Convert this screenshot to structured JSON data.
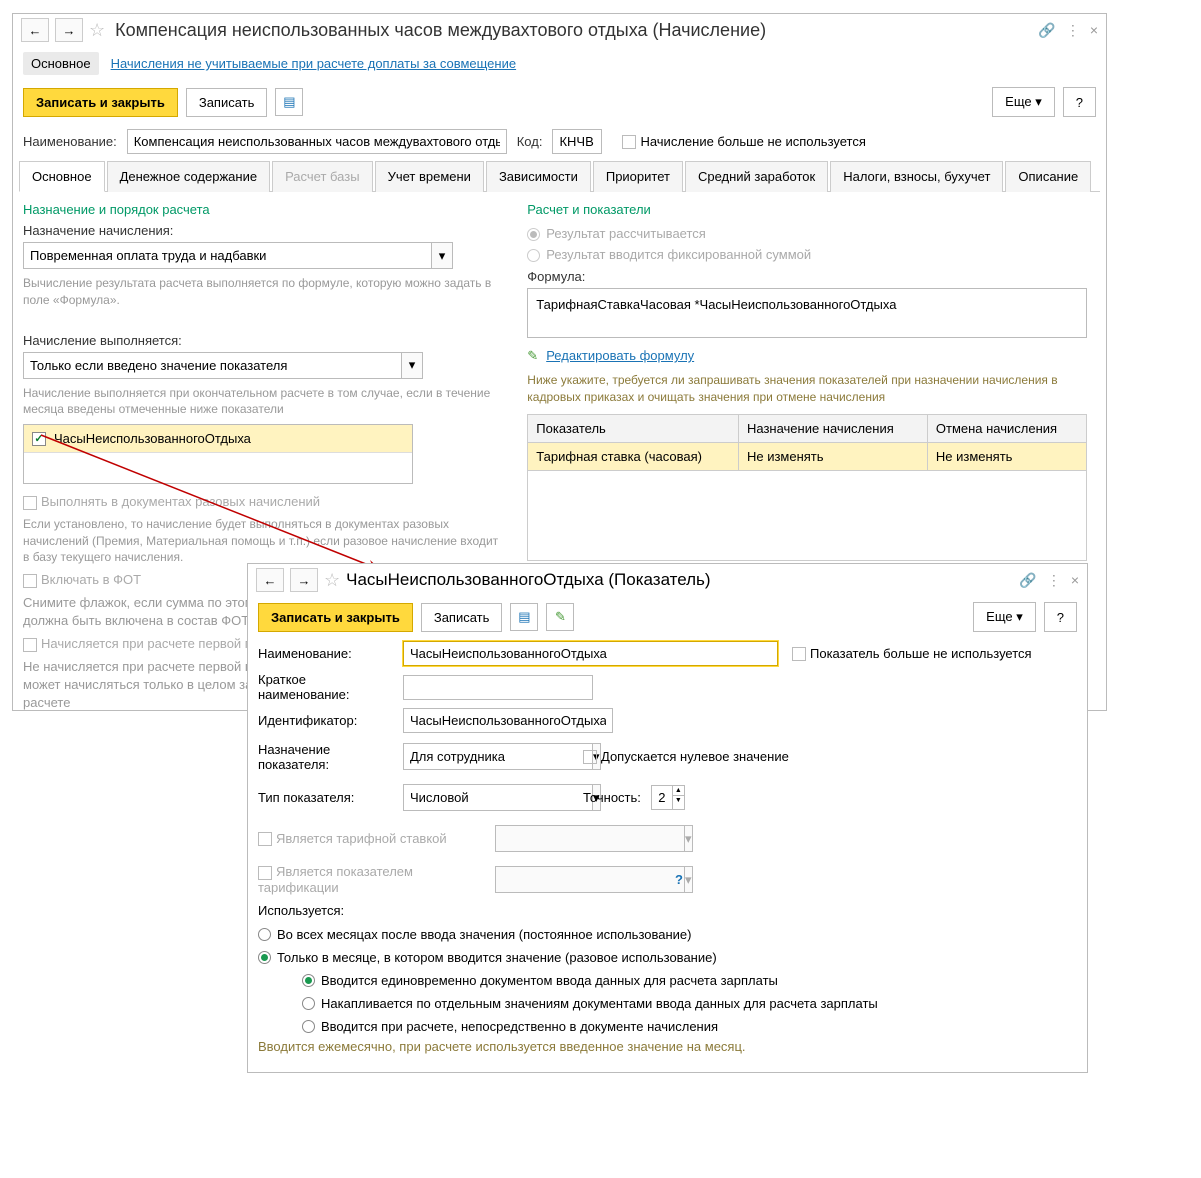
{
  "main": {
    "title": "Компенсация неиспользованных часов междувахтового отдыха (Начисление)",
    "subnav_main": "Основное",
    "subnav_link": "Начисления не учитываемые при расчете доплаты за совмещение",
    "btn_save_close": "Записать и закрыть",
    "btn_save": "Записать",
    "btn_more": "Еще",
    "name_lbl": "Наименование:",
    "name_val": "Компенсация неиспользованных часов междувахтового отдыха",
    "code_lbl": "Код:",
    "code_val": "КНЧВ",
    "not_used": "Начисление больше не используется",
    "tabs": [
      "Основное",
      "Денежное содержание",
      "Расчет базы",
      "Учет времени",
      "Зависимости",
      "Приоритет",
      "Средний заработок",
      "Налоги, взносы, бухучет",
      "Описание"
    ],
    "left": {
      "h1": "Назначение и порядок расчета",
      "lbl1": "Назначение начисления:",
      "sel1": "Повременная оплата труда и надбавки",
      "help1": "Вычисление результата расчета выполняется по формуле, которую можно задать в поле «Формула».",
      "lbl2": "Начисление выполняется:",
      "sel2": "Только если введено значение показателя",
      "help2": "Начисление выполняется при окончательном расчете в том случае, если в течение месяца введены отмеченные ниже показатели",
      "item": "ЧасыНеиспользованногоОтдыха",
      "chk1": "Выполнять в документах разовых начислений",
      "help3": "Если установлено, то начисление будет выполняться в документах разовых начислений (Премия, Материальная помощь и т.п.) если разовое начисление входит в базу текущего начисления.",
      "chk2": "Включать в ФОТ",
      "help4a": "Снимите флажок, если сумма по этому н",
      "help4b": "должна быть включена в состав ФОТ",
      "chk3": "Начисляется при расчете первой пол",
      "help5a": "Не начисляется при расчете первой поло",
      "help5b": "может начисляться только в целом за ме",
      "help5c": "расчете"
    },
    "right": {
      "h1": "Расчет и показатели",
      "r1": "Результат рассчитывается",
      "r2": "Результат вводится фиксированной суммой",
      "lbl_f": "Формула:",
      "formula": "ТарифнаяСтавкаЧасовая *ЧасыНеиспользованногоОтдыха",
      "edit": "Редактировать формулу",
      "help": "Ниже укажите, требуется ли запрашивать значения показателей при назначении начисления в кадровых приказах и очищать значения при отмене начисления",
      "th1": "Показатель",
      "th2": "Назначение начисления",
      "th3": "Отмена начисления",
      "td1": "Тарифная ставка (часовая)",
      "td2": "Не изменять",
      "td3": "Не изменять"
    }
  },
  "popup": {
    "title": "ЧасыНеиспользованногоОтдыха (Показатель)",
    "btn_save_close": "Записать и закрыть",
    "btn_save": "Записать",
    "btn_more": "Еще",
    "name_lbl": "Наименование:",
    "name_val": "ЧасыНеиспользованногоОтдыха",
    "not_used": "Показатель больше не используется",
    "short_lbl": "Краткое наименование:",
    "id_lbl": "Идентификатор:",
    "id_val": "ЧасыНеиспользованногоОтдыха",
    "purpose_lbl": "Назначение показателя:",
    "purpose_val": "Для сотрудника",
    "allow_zero": "Допускается нулевое значение",
    "type_lbl": "Тип показателя:",
    "type_val": "Числовой",
    "prec_lbl": "Точность:",
    "prec_val": "2",
    "tariff": "Является тарифной ставкой",
    "tariff2": "Является показателем тарификации",
    "used_lbl": "Используется:",
    "u1": "Во всех месяцах после ввода значения (постоянное использование)",
    "u2": "Только в месяце, в котором вводится значение (разовое использование)",
    "s1": "Вводится единовременно документом ввода данных для расчета зарплаты",
    "s2": "Накапливается по отдельным значениям документами ввода данных для расчета зарплаты",
    "s3": "Вводится при расчете, непосредственно в документе начисления",
    "footer": "Вводится ежемесячно, при расчете используется введенное значение на месяц."
  }
}
